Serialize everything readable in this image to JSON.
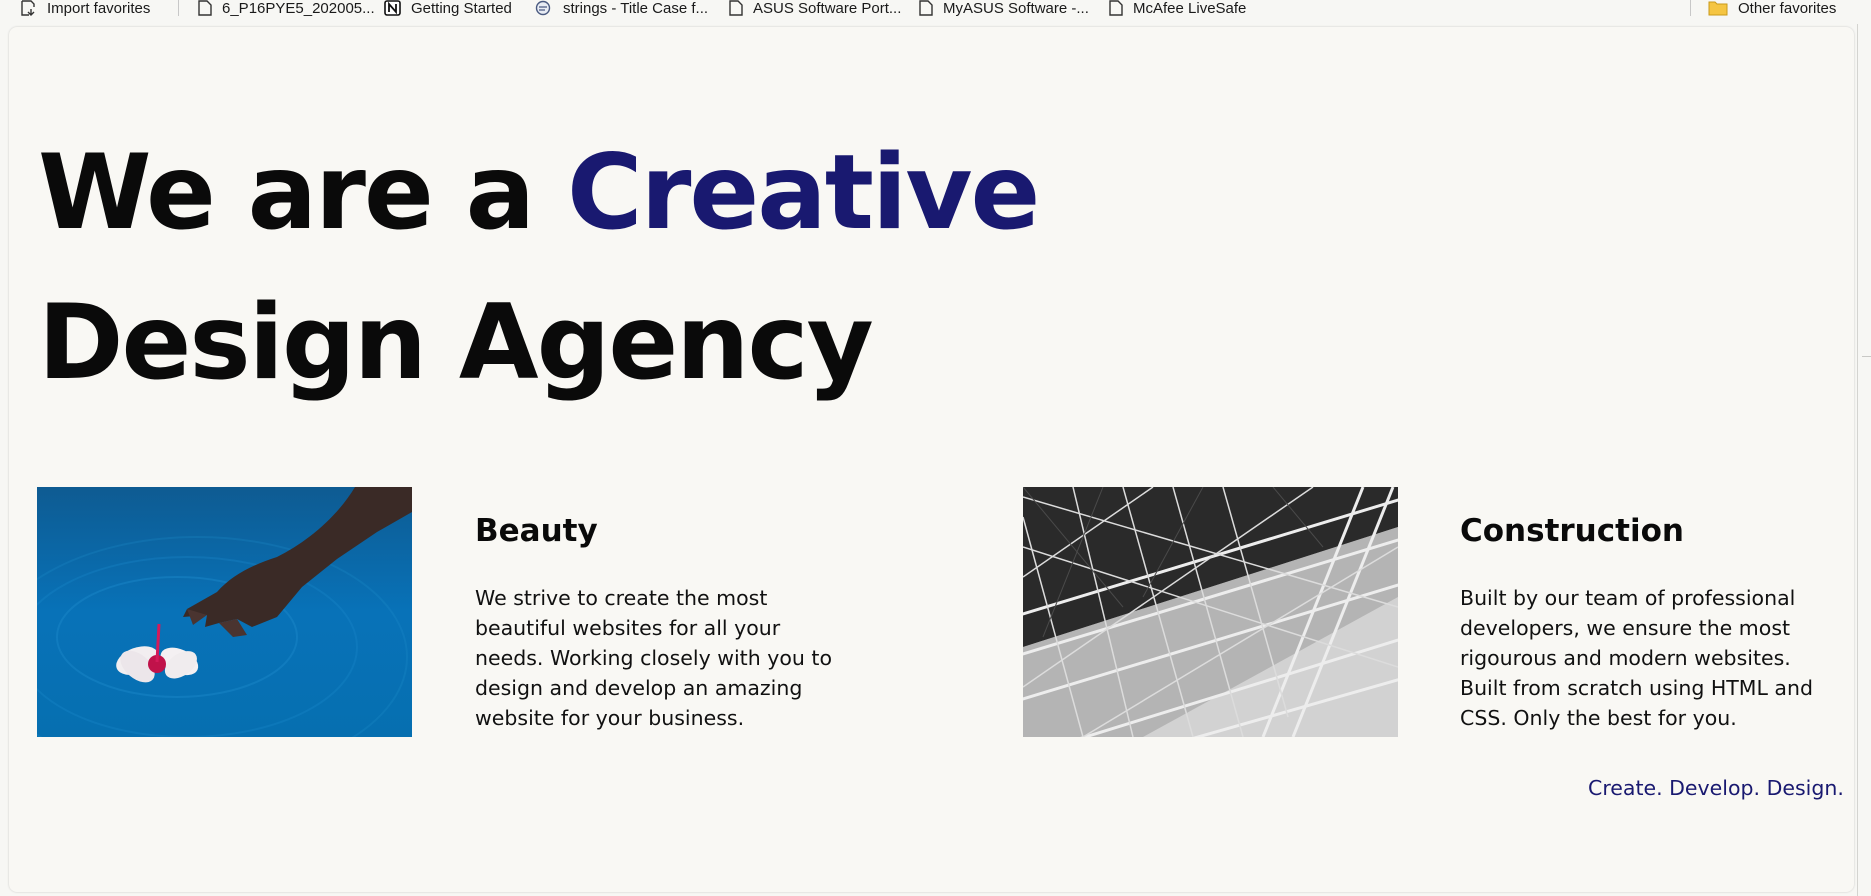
{
  "favorites_bar": {
    "items": [
      {
        "label": "Import favorites",
        "icon": "import-icon"
      },
      {
        "label": "6_P16PYE5_202005...",
        "icon": "page-icon"
      },
      {
        "label": "Getting Started",
        "icon": "notion-icon"
      },
      {
        "label": "strings - Title Case f...",
        "icon": "search-site-icon"
      },
      {
        "label": "ASUS Software Port...",
        "icon": "page-icon"
      },
      {
        "label": "MyASUS Software -...",
        "icon": "page-icon"
      },
      {
        "label": "McAfee LiveSafe",
        "icon": "page-icon"
      }
    ],
    "other_favorites": "Other favorites"
  },
  "hero": {
    "line1_prefix": "We are a",
    "line1_accent": "Creative",
    "line2": "Design Agency",
    "accent_color": "#191970"
  },
  "cards": [
    {
      "title": "Beauty",
      "text": "We strive to create the most beautiful websites for all your needs. Working closely with you to design and develop an amazing website for your business.",
      "image": "hand-flower-water-photo"
    },
    {
      "title": "Construction",
      "text": "Built by our team of professional developers, we ensure the most rigourous and modern websites. Built from scratch using HTML and CSS. Only the best for you.",
      "image": "steel-structure-photo"
    }
  ],
  "tagline": "Create. Develop. Design."
}
